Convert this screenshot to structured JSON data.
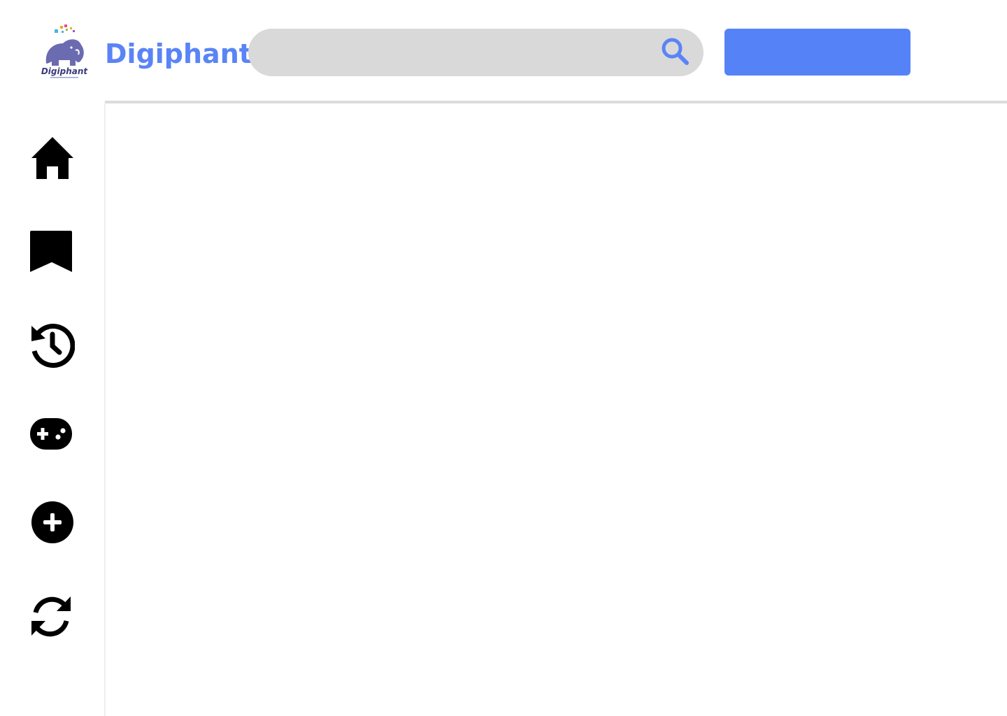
{
  "header": {
    "brand_name": "Digiphant",
    "logo_text": "Digiphant",
    "search": {
      "placeholder": "",
      "value": ""
    },
    "primary_button_label": ""
  },
  "colors": {
    "brand": "#5a84f6",
    "button": "#5682f8",
    "search_bg": "#d9d9d9",
    "elephant": "#6a6bb0",
    "icon": "#000000"
  },
  "sidebar": {
    "items": [
      {
        "icon": "home-icon"
      },
      {
        "icon": "bookmark-icon"
      },
      {
        "icon": "history-icon"
      },
      {
        "icon": "gamepad-icon"
      },
      {
        "icon": "plus-circle-icon"
      },
      {
        "icon": "refresh-icon"
      }
    ]
  }
}
